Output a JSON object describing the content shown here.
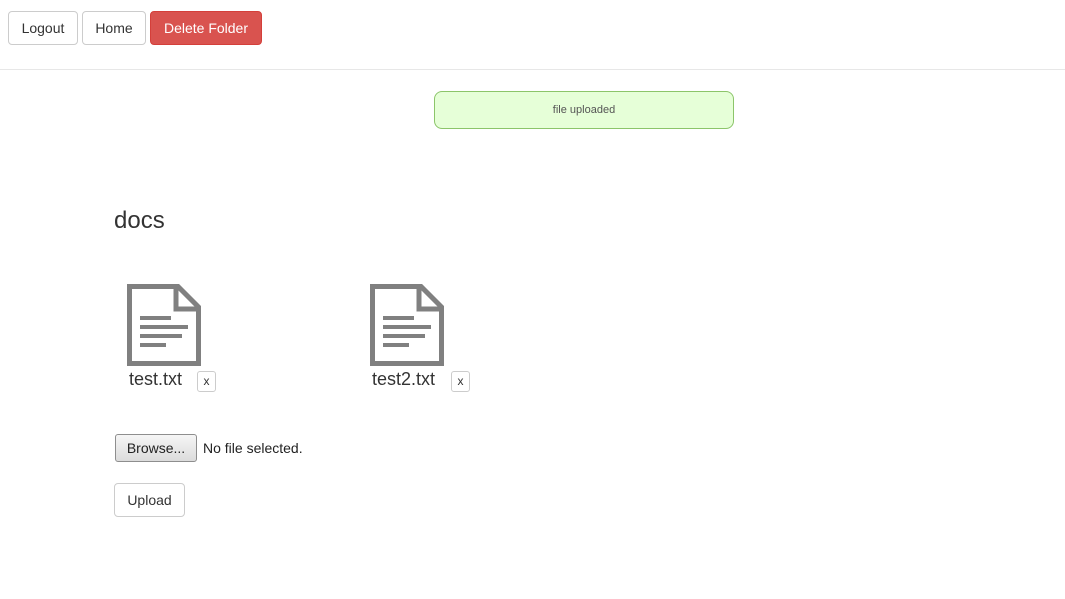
{
  "header": {
    "logout_label": "Logout",
    "home_label": "Home",
    "delete_folder_label": "Delete Folder"
  },
  "alert": {
    "message": "file uploaded"
  },
  "folder": {
    "name": "docs"
  },
  "files": [
    {
      "name": "test.txt",
      "delete_label": "x",
      "icon": "document-icon"
    },
    {
      "name": "test2.txt",
      "delete_label": "x",
      "icon": "document-icon"
    }
  ],
  "upload": {
    "browse_label": "Browse...",
    "status_text": "No file selected.",
    "upload_label": "Upload"
  },
  "colors": {
    "danger": "#d9534f",
    "success_bg": "#e6ffd8",
    "success_border": "#8cc56a",
    "icon_gray": "#808080"
  }
}
